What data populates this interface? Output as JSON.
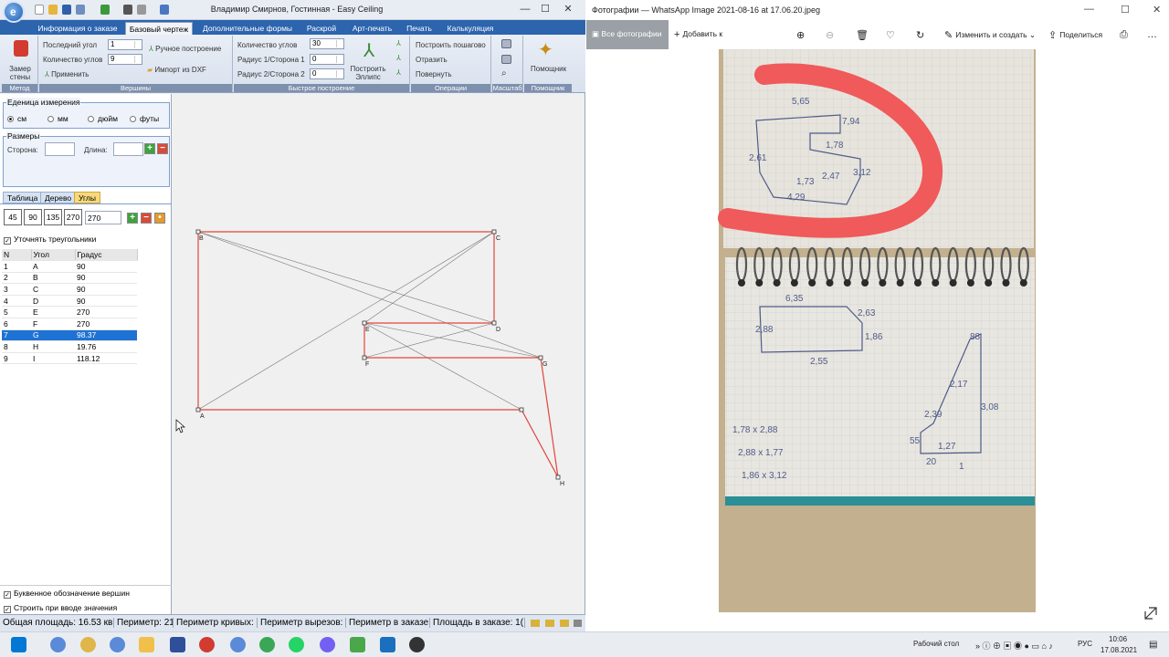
{
  "left_window": {
    "title": "Владимир Смирнов, Гостинная - Easy Ceiling",
    "tabs": [
      "Информация о заказе",
      "Базовый чертеж",
      "Дополнительные формы",
      "Раскрой",
      "Арт-печать",
      "Печать",
      "Калькуляция"
    ],
    "active_tab": "Базовый чертеж",
    "ribbon": {
      "method": {
        "button": "Замер стены",
        "group": "Метод"
      },
      "vertices": {
        "last_angle_label": "Последний угол",
        "last_angle_value": "1",
        "count_label": "Количество углов",
        "count_value": "9",
        "apply": "Применить",
        "manual": "Ручное построение",
        "import": "Импорт из DXF",
        "group": "Вершины"
      },
      "quick": {
        "count_label": "Количество углов",
        "count_value": "30",
        "r1_label": "Радиус 1/Сторона 1",
        "r1_value": "0",
        "r2_label": "Радиус 2/Сторона 2",
        "r2_value": "0",
        "ellipse": "Построить Эллипс",
        "group": "Быстрое построение"
      },
      "operations": {
        "step": "Построить пошагово",
        "mirror": "Отразить",
        "rotate": "Повернуть",
        "group": "Операции"
      },
      "scale": {
        "group": "Масштаб"
      },
      "helper": {
        "button": "Помощник",
        "group": "Помощник"
      }
    },
    "units": {
      "title": "Еденица измерения",
      "options": [
        "см",
        "мм",
        "дюйм",
        "футы"
      ],
      "selected": "см"
    },
    "sizes": {
      "title": "Размеры",
      "side_label": "Сторона:",
      "length_label": "Длина:"
    },
    "panel_tabs": [
      "Таблица",
      "Дерево",
      "Углы"
    ],
    "active_panel_tab": "Углы",
    "angle_buttons": [
      "45",
      "90",
      "135",
      "270"
    ],
    "angle_input": "270",
    "refine_label": "Уточнять треугольники",
    "table": {
      "headers": [
        "N",
        "Угол",
        "Градус"
      ],
      "rows": [
        [
          "1",
          "A",
          "90"
        ],
        [
          "2",
          "B",
          "90"
        ],
        [
          "3",
          "C",
          "90"
        ],
        [
          "4",
          "D",
          "90"
        ],
        [
          "5",
          "E",
          "270"
        ],
        [
          "6",
          "F",
          "270"
        ],
        [
          "7",
          "G",
          "98.37"
        ],
        [
          "8",
          "H",
          "19.76"
        ],
        [
          "9",
          "I",
          "118.12"
        ]
      ],
      "selected_row": 6
    },
    "letter_label": "Буквенное обозначение вершин",
    "build_label": "Строить при вводе значения",
    "drawing": {
      "vertex_labels": [
        "A",
        "B",
        "C",
        "D",
        "E",
        "F",
        "G",
        "H"
      ]
    },
    "status": [
      "Общая площадь: 16.53 кв",
      "Периметр: 21",
      "Периметр кривых:",
      "Периметр вырезов:",
      "Периметр в заказе",
      "Площадь в заказе: 1("
    ]
  },
  "right_window": {
    "title": "Фотографии — WhatsApp Image 2021-08-16 at 17.06.20.jpeg",
    "all_photos": "Все фотографии",
    "add_to": "Добавить к",
    "edit_create": "Изменить и создать",
    "share": "Поделиться",
    "photo_notes": [
      "5,65",
      "7,94",
      "2,61",
      "1,78",
      "3,12",
      "4,29",
      "1,73",
      "2,47",
      "2,55",
      "6,35",
      "1,86",
      "2,88",
      "2,63",
      "1,27",
      "88",
      "2,17",
      "3,08",
      "2,39",
      "55",
      "20",
      "1",
      "1,78 x 2,88",
      "2,88 x 1,77",
      "1,86 x 3,12"
    ]
  },
  "taskbar": {
    "desktop": "Рабочий стол",
    "lang": "РУС",
    "time": "10:06",
    "date": "17.08.2021"
  },
  "colors": {
    "accent": "#2c64ad",
    "outline": "#e0463b",
    "selection": "#1e72d4",
    "marker": "#f05a5a"
  }
}
